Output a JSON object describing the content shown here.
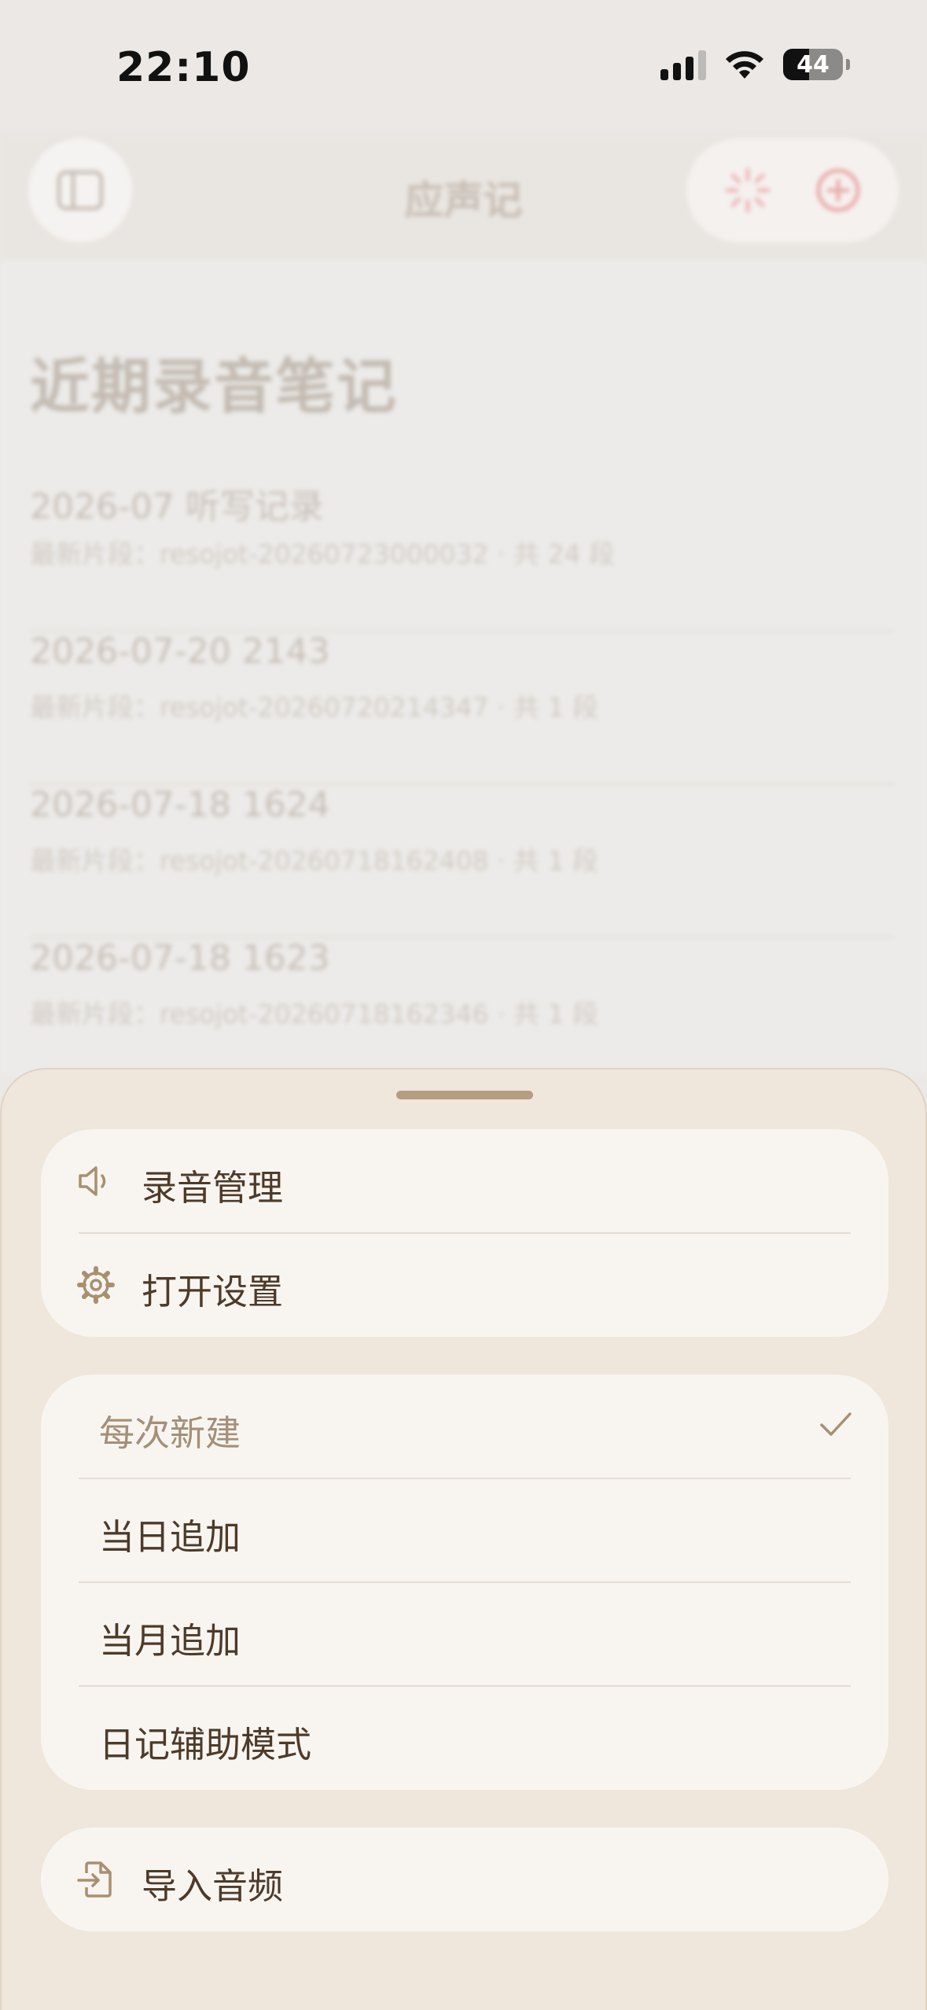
{
  "status_bar": {
    "time": "22:10",
    "battery": "44",
    "battery_level": 0.44
  },
  "nav": {
    "title": "应声记"
  },
  "main": {
    "section_title": "近期录音笔记",
    "items": [
      {
        "title": "2026-07 听写记录",
        "subtitle": "最新片段：resojot-20260723000032 · 共 24 段"
      },
      {
        "title": "2026-07-20 2143",
        "subtitle": "最新片段：resojot-20260720214347 · 共 1 段"
      },
      {
        "title": "2026-07-18 1624",
        "subtitle": "最新片段：resojot-20260718162408 · 共 1 段"
      },
      {
        "title": "2026-07-18 1623",
        "subtitle": "最新片段：resojot-20260718162346 · 共 1 段"
      }
    ]
  },
  "sheet": {
    "group1": [
      {
        "label": "录音管理",
        "icon": "speaker-icon"
      },
      {
        "label": "打开设置",
        "icon": "gear-icon"
      }
    ],
    "modes": [
      {
        "label": "每次新建",
        "selected": true
      },
      {
        "label": "当日追加",
        "selected": false
      },
      {
        "label": "当月追加",
        "selected": false
      },
      {
        "label": "日记辅助模式",
        "selected": false
      }
    ],
    "import": {
      "label": "导入音频",
      "icon": "import-file-icon"
    }
  },
  "colors": {
    "sheet_bg": "#efe6dc",
    "group_bg": "#f8f5f1",
    "text_primary": "#4d3a28",
    "text_selected": "#a48f78",
    "accent_icon": "#a8906f",
    "record_accent": "#e8a6a6"
  }
}
